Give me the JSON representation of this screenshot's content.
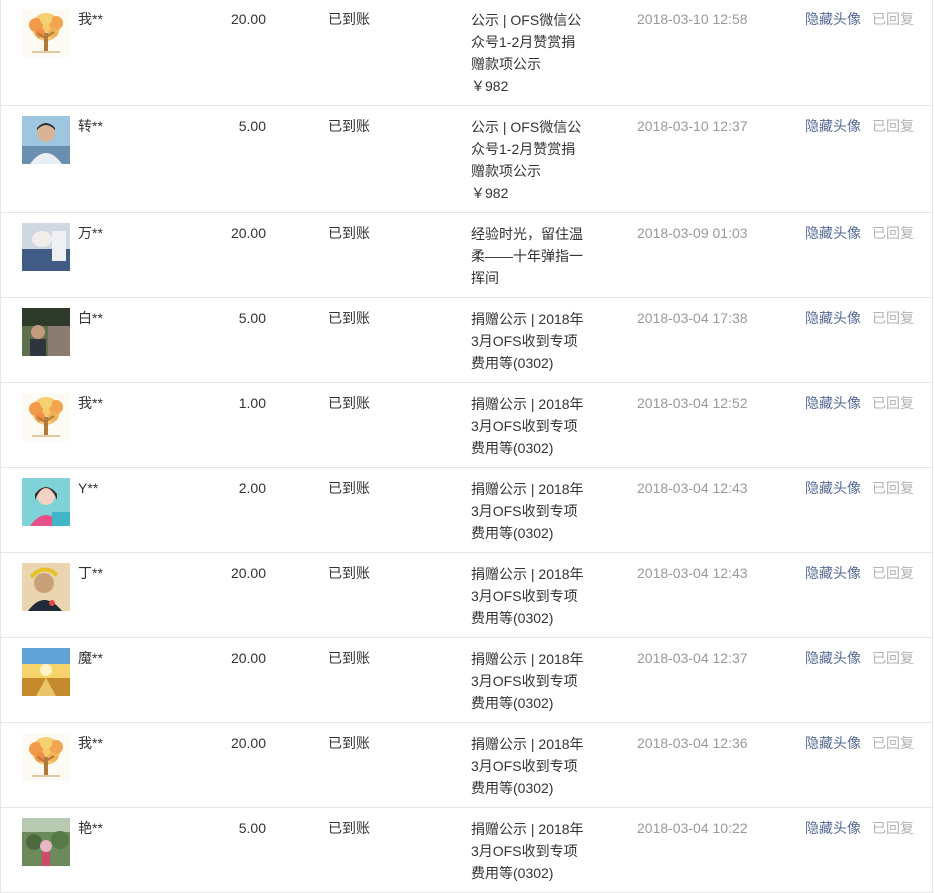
{
  "rows": [
    {
      "nickname": "我**",
      "amount": "20.00",
      "status": "已到账",
      "article": "公示 | OFS微信公众号1-2月赞赏捐赠款项公示\n￥982",
      "time": "2018-03-10 12:58",
      "hide_label": "隐藏头像",
      "reply_status": "已回复",
      "avatar": "tree-avatar-icon"
    },
    {
      "nickname": "转**",
      "amount": "5.00",
      "status": "已到账",
      "article": "公示 | OFS微信公众号1-2月赞赏捐赠款项公示\n￥982",
      "time": "2018-03-10 12:37",
      "hide_label": "隐藏头像",
      "reply_status": "已回复",
      "avatar": "person-photo-avatar-icon"
    },
    {
      "nickname": "万**",
      "amount": "20.00",
      "status": "已到账",
      "article": "经验时光，留住温柔——十年弹指一挥间",
      "time": "2018-03-09 01:03",
      "hide_label": "隐藏头像",
      "reply_status": "已回复",
      "avatar": "hand-photo-avatar-icon"
    },
    {
      "nickname": "白**",
      "amount": "5.00",
      "status": "已到账",
      "article": "捐赠公示 | 2018年3月OFS收到专项费用等(0302)",
      "time": "2018-03-04 17:38",
      "hide_label": "隐藏头像",
      "reply_status": "已回复",
      "avatar": "outdoor-photo-avatar-icon"
    },
    {
      "nickname": "我**",
      "amount": "1.00",
      "status": "已到账",
      "article": "捐赠公示 | 2018年3月OFS收到专项费用等(0302)",
      "time": "2018-03-04 12:52",
      "hide_label": "隐藏头像",
      "reply_status": "已回复",
      "avatar": "tree-avatar-icon"
    },
    {
      "nickname": "Y**",
      "amount": "2.00",
      "status": "已到账",
      "article": "捐赠公示 | 2018年3月OFS收到专项费用等(0302)",
      "time": "2018-03-04 12:43",
      "hide_label": "隐藏头像",
      "reply_status": "已回复",
      "avatar": "woman-photo-avatar-icon"
    },
    {
      "nickname": "丁**",
      "amount": "20.00",
      "status": "已到账",
      "article": "捐赠公示 | 2018年3月OFS收到专项费用等(0302)",
      "time": "2018-03-04 12:43",
      "hide_label": "隐藏头像",
      "reply_status": "已回复",
      "avatar": "child-photo-avatar-icon"
    },
    {
      "nickname": "魔**",
      "amount": "20.00",
      "status": "已到账",
      "article": "捐赠公示 | 2018年3月OFS收到专项费用等(0302)",
      "time": "2018-03-04 12:37",
      "hide_label": "隐藏头像",
      "reply_status": "已回复",
      "avatar": "sunset-road-avatar-icon"
    },
    {
      "nickname": "我**",
      "amount": "20.00",
      "status": "已到账",
      "article": "捐赠公示 | 2018年3月OFS收到专项费用等(0302)",
      "time": "2018-03-04 12:36",
      "hide_label": "隐藏头像",
      "reply_status": "已回复",
      "avatar": "tree-avatar-icon"
    },
    {
      "nickname": "艳**",
      "amount": "5.00",
      "status": "已到账",
      "article": "捐赠公示 | 2018年3月OFS收到专项费用等(0302)",
      "time": "2018-03-04 10:22",
      "hide_label": "隐藏头像",
      "reply_status": "已回复",
      "avatar": "garden-photo-avatar-icon"
    }
  ]
}
